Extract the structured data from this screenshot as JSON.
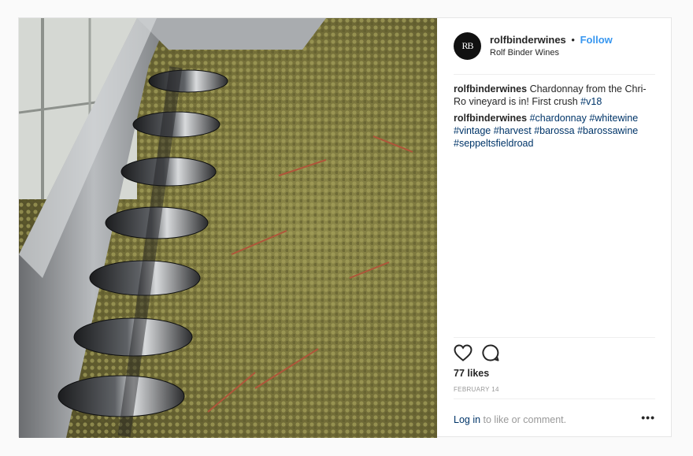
{
  "post": {
    "avatar_initials": "RB",
    "username": "rolfbinderwines",
    "separator": "•",
    "follow_label": "Follow",
    "display_name": "Rolf Binder Wines",
    "caption_user": "rolfbinderwines",
    "caption_text": "Chardonnay from the Chri-Ro vineyard is in! First crush ",
    "caption_tag": "#v18",
    "comment_user": "rolfbinderwines",
    "hashtags": [
      "#chardonnay",
      "#whitewine",
      "#vintage",
      "#harvest",
      "#barossa",
      "#barossawine",
      "#seppeltsfieldroad"
    ],
    "likes": "77 likes",
    "date": "FEBRUARY 14",
    "login_link": "Log in",
    "login_text": " to like or comment.",
    "more_label": "•••"
  },
  "colors": {
    "link_blue": "#3897f0",
    "hashtag_blue": "#003569",
    "muted": "#999999"
  },
  "icons": [
    "heart-icon",
    "comment-icon",
    "more-options-icon"
  ]
}
